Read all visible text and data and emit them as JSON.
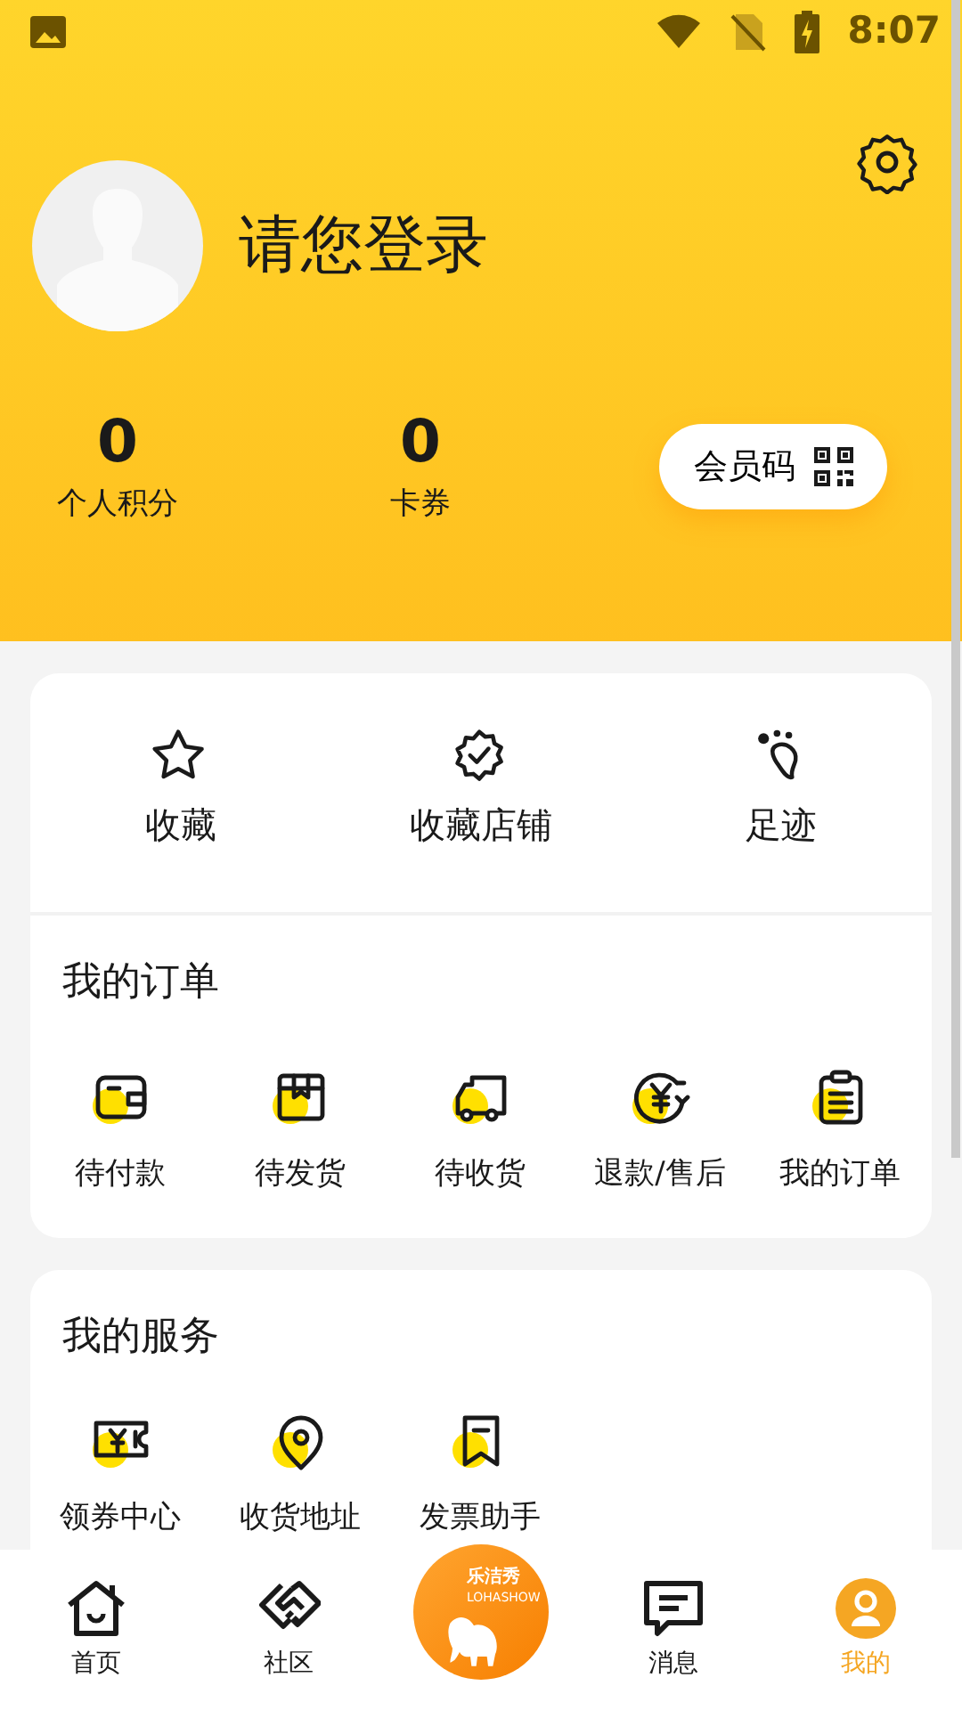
{
  "status_bar": {
    "time": "8:07"
  },
  "profile": {
    "login_prompt": "请您登录"
  },
  "stats": [
    {
      "value": "0",
      "label": "个人积分"
    },
    {
      "value": "0",
      "label": "卡券"
    }
  ],
  "member_code_button": {
    "label": "会员码"
  },
  "shortcuts": [
    {
      "label": "收藏"
    },
    {
      "label": "收藏店铺"
    },
    {
      "label": "足迹"
    }
  ],
  "orders": {
    "title": "我的订单",
    "items": [
      {
        "label": "待付款"
      },
      {
        "label": "待发货"
      },
      {
        "label": "待收货"
      },
      {
        "label": "退款/售后"
      },
      {
        "label": "我的订单"
      }
    ]
  },
  "services": {
    "title": "我的服务",
    "items": [
      {
        "label": "领券中心"
      },
      {
        "label": "收货地址"
      },
      {
        "label": "发票助手"
      }
    ]
  },
  "bottom_nav": [
    {
      "kind": "tab",
      "label": "首页",
      "selected": false
    },
    {
      "kind": "tab",
      "label": "社区",
      "selected": false
    },
    {
      "kind": "logo",
      "label": "乐洁秀",
      "sublabel": "LOHASHOW",
      "selected": false
    },
    {
      "kind": "tab",
      "label": "消息",
      "selected": false
    },
    {
      "kind": "tab",
      "label": "我的",
      "selected": true
    }
  ]
}
